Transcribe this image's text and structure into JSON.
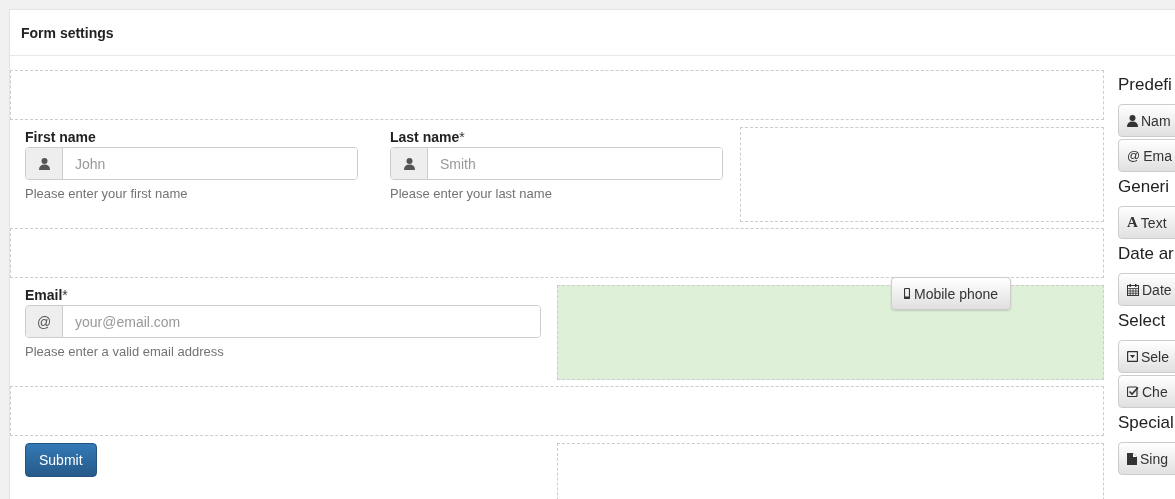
{
  "panel": {
    "title": "Form settings"
  },
  "rows": [
    {
      "kind": "empty"
    },
    {
      "kind": "fields",
      "fields": [
        {
          "kind": "person",
          "label": "First name",
          "placeholder": "John",
          "help": "Please enter your first name"
        },
        {
          "kind": "person",
          "label": "Last name",
          "mark": "*",
          "placeholder": "Smith",
          "help": "Please enter your last name"
        }
      ],
      "slot": {
        "highlighted": false
      }
    },
    {
      "kind": "empty"
    },
    {
      "kind": "fields",
      "fields": [
        {
          "kind": "at",
          "addon": "@",
          "label": "Email",
          "mark": "*",
          "placeholder": "your@email.com",
          "help": "Please enter a valid email address"
        }
      ],
      "slot": {
        "highlighted": true,
        "dragged": {
          "kind": "phone",
          "label": "Mobile phone"
        }
      }
    },
    {
      "kind": "empty"
    },
    {
      "kind": "submit",
      "button": "Submit",
      "slot": {
        "highlighted": false
      }
    }
  ],
  "sidebar": [
    {
      "heading": "Predefi",
      "buttons": [
        {
          "kind": "user",
          "label": "Nam"
        },
        {
          "kind": "glyph",
          "glyph": "@",
          "label": "Ema"
        }
      ]
    },
    {
      "heading": "Generi",
      "buttons": [
        {
          "kind": "serif",
          "glyph": "A",
          "label": "Text"
        }
      ]
    },
    {
      "heading": "Date ar",
      "buttons": [
        {
          "kind": "calendar",
          "label": "Date"
        }
      ]
    },
    {
      "heading": "Select",
      "buttons": [
        {
          "kind": "select",
          "label": "Sele"
        },
        {
          "kind": "checkbox",
          "label": "Che"
        }
      ]
    },
    {
      "heading": "Special",
      "buttons": [
        {
          "kind": "file",
          "label": "Sing"
        }
      ]
    }
  ]
}
